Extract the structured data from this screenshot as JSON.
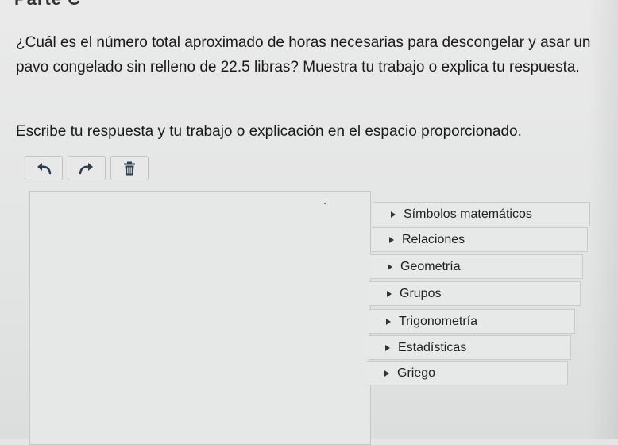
{
  "header": {
    "partial_heading": "Parte C"
  },
  "question": {
    "text": "¿Cuál es el número total aproximado de horas necesarias para descongelar y asar un pavo congelado sin relleno de 22.5 libras? Muestra tu trabajo o explica tu respuesta."
  },
  "instruction": {
    "text": "Escribe tu respuesta y tu trabajo o explicación en el espacio proporcionado."
  },
  "toolbar": {
    "buttons": [
      {
        "icon": "undo-icon"
      },
      {
        "icon": "redo-icon"
      },
      {
        "icon": "trash-icon"
      }
    ]
  },
  "answer_area": {
    "value": ""
  },
  "palette": {
    "categories": [
      {
        "label": "Símbolos matemáticos"
      },
      {
        "label": "Relaciones"
      },
      {
        "label": "Geometría"
      },
      {
        "label": "Grupos"
      },
      {
        "label": "Trigonometría"
      },
      {
        "label": "Estadísticas"
      },
      {
        "label": "Griego"
      }
    ]
  },
  "colors": {
    "background": "#e4e5e5",
    "text": "#1a1a1a",
    "border": "#c6c7c7"
  }
}
